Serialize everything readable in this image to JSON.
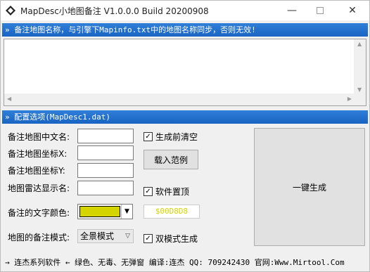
{
  "window": {
    "title": "MapDesc小地图备注 V1.0.0.0 Build 20200908",
    "min_icon": "minimize-icon",
    "max_icon": "maximize-icon",
    "close_icon": "close-icon"
  },
  "section1": {
    "header": "» 备注地图名称，与引擎下Mapinfo.txt中的地图名称同步，否则无效!",
    "memo_value": ""
  },
  "section2": {
    "header": "» 配置选项(MapDesc1.dat)"
  },
  "form": {
    "cn_name_label": "备注地图中文名:",
    "cn_name_value": "",
    "x_label": "备注地图坐标X:",
    "x_value": "",
    "y_label": "备注地图坐标Y:",
    "y_value": "",
    "radar_label": "地图雷达显示名:",
    "radar_value": "",
    "color_label": "备注的文字颜色:",
    "color_hex": "$00D8D8",
    "mode_label": "地图的备注模式:",
    "mode_value": "全景模式"
  },
  "options": {
    "clear_before_gen": {
      "label": "生成前清空",
      "checked": true
    },
    "topmost": {
      "label": "软件置顶",
      "checked": true
    },
    "dual_mode": {
      "label": "双模式生成",
      "checked": true
    }
  },
  "buttons": {
    "load_example": "载入范例",
    "generate": "一键生成"
  },
  "status_bar": {
    "text": "→ 连杰系列软件 ← 绿色、无毒、无弹窗 编译:连杰 QQ: 709242430 官网:Www.Mirtool.Com"
  },
  "colors": {
    "section_bar": "#1e6ccb",
    "color_swatch": "#d4d400"
  }
}
